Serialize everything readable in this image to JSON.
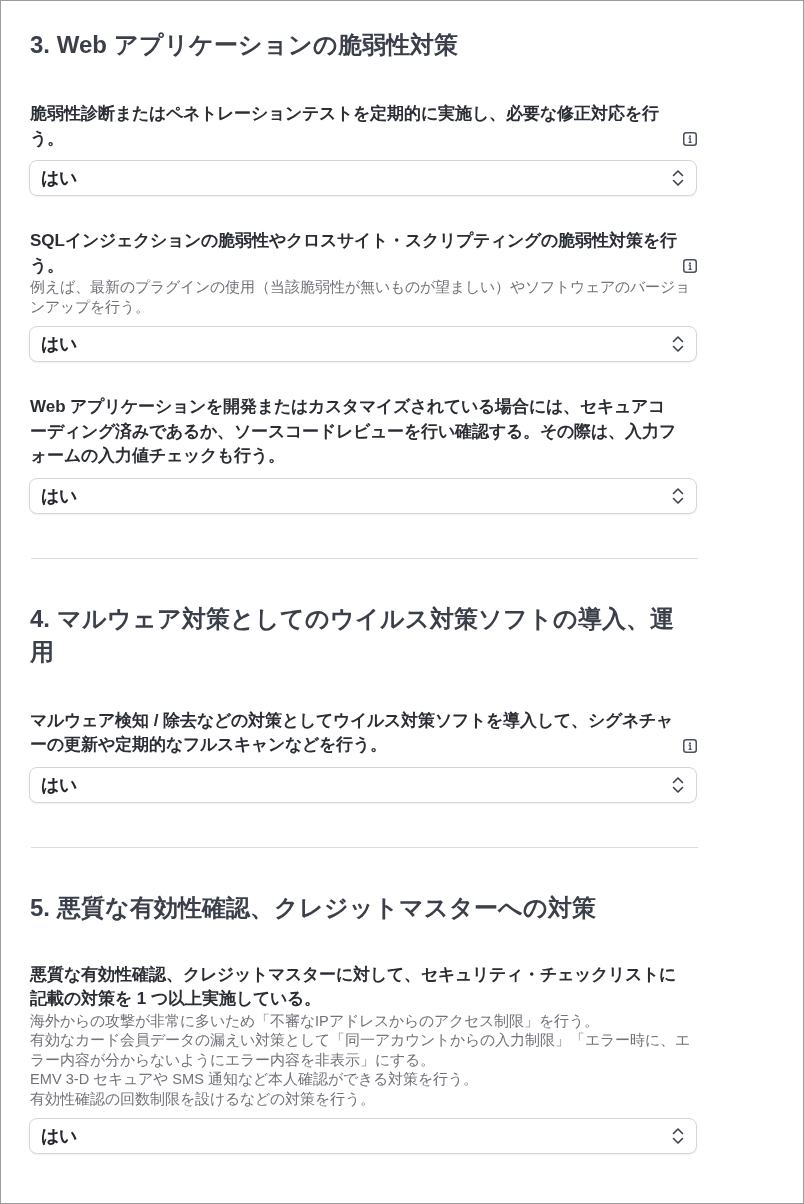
{
  "sections": [
    {
      "title": "3. Web アプリケーションの脆弱性対策",
      "questions": [
        {
          "label": "脆弱性診断またはペネトレーションテストを定期的に実施し、必要な修正対応を行う。",
          "info_icon": true,
          "answer": "はい"
        },
        {
          "label": "SQLインジェクションの脆弱性やクロスサイト・スクリプティングの脆弱性対策を行う。",
          "info_icon": true,
          "hints": [
            "例えば、最新のプラグインの使用（当該脆弱性が無いものが望ましい）やソフトウェアのバージョンアップを行う。"
          ],
          "answer": "はい"
        },
        {
          "label": "Web アプリケーションを開発またはカスタマイズされている場合には、セキュアコーディング済みであるか、ソースコードレビューを行い確認する。その際は、入力フォームの入力値チェックも行う。",
          "info_icon": false,
          "answer": "はい"
        }
      ]
    },
    {
      "title": "4. マルウェア対策としてのウイルス対策ソフトの導入、運用",
      "questions": [
        {
          "label": "マルウェア検知 / 除去などの対策としてウイルス対策ソフトを導入して、シグネチャーの更新や定期的なフルスキャンなどを行う。",
          "info_icon": true,
          "answer": "はい"
        }
      ]
    },
    {
      "title": "5. 悪質な有効性確認、クレジットマスターへの対策",
      "questions": [
        {
          "label": "悪質な有効性確認、クレジットマスターに対して、セキュリティ・チェックリストに記載の対策を 1 つ以上実施している。",
          "info_icon": false,
          "hints": [
            "海外からの攻撃が非常に多いため「不審なIPアドレスからのアクセス制限」を行う。",
            "有効なカード会員データの漏えい対策として「同一アカウントからの入力制限」「エラー時に、エラー内容が分からないようにエラー内容を非表示」にする。",
            "EMV 3-D セキュアや SMS 通知など本人確認ができる対策を行う。",
            "有効性確認の回数制限を設けるなどの対策を行う。"
          ],
          "answer": "はい"
        }
      ]
    }
  ]
}
